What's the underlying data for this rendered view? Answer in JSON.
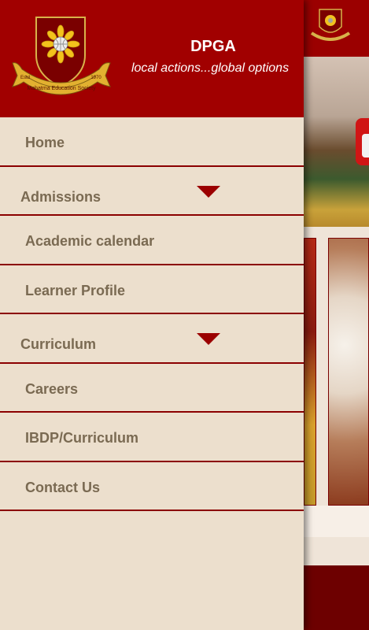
{
  "drawer": {
    "title": "DPGA",
    "tagline": "local actions...global options",
    "logo_text": "Mahatma Education Society",
    "logo_left": "Estd",
    "logo_right": "1970",
    "items": [
      {
        "label": "Home"
      },
      {
        "label": "Admissions",
        "expandable": true
      },
      {
        "label": "Academic calendar"
      },
      {
        "label": "Learner Profile"
      },
      {
        "label": "Curriculum",
        "expandable": true
      },
      {
        "label": "Careers"
      },
      {
        "label": "IBDP/Curriculum"
      },
      {
        "label": "Contact Us"
      }
    ]
  },
  "colors": {
    "header_red": "#a10000",
    "drawer_bg": "#ecdfcd",
    "text": "#7a6a52",
    "divider": "#8b0000"
  }
}
